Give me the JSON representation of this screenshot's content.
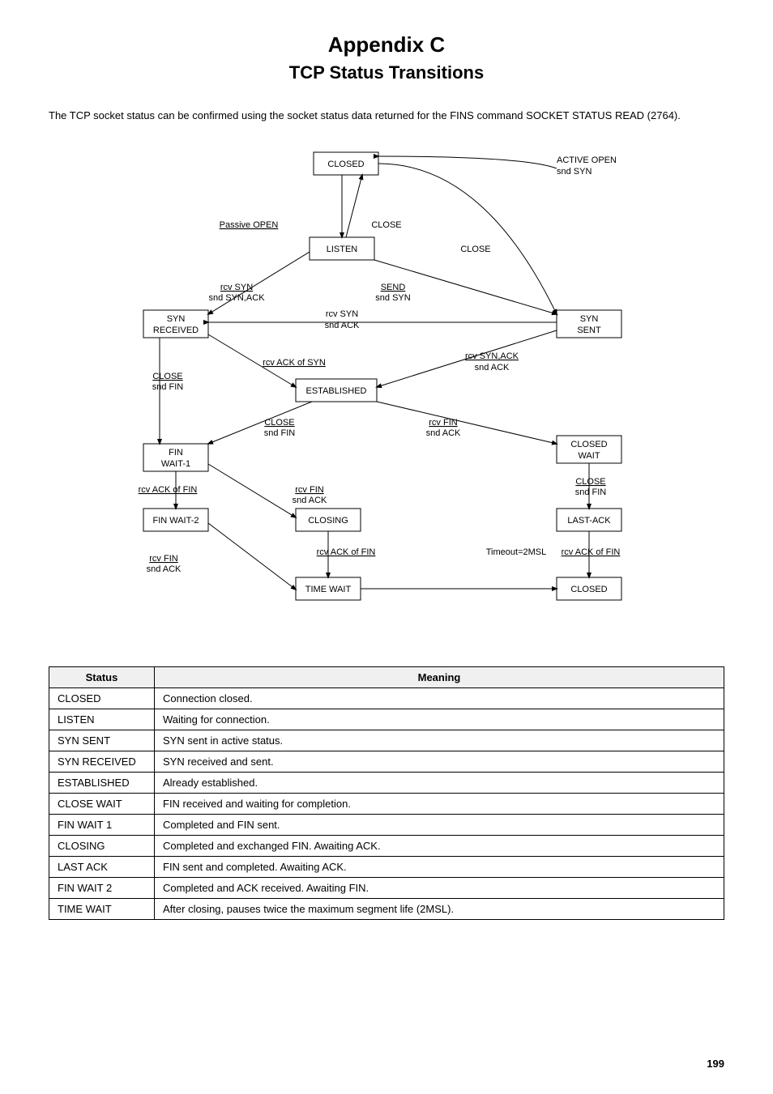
{
  "title": "Appendix C",
  "subtitle": "TCP Status Transitions",
  "intro": "The TCP socket status can be confirmed using the socket status data returned for the FINS command SOCKET STATUS READ (2764).",
  "table": {
    "headers": [
      "Status",
      "Meaning"
    ],
    "rows": [
      [
        "CLOSED",
        "Connection closed."
      ],
      [
        "LISTEN",
        "Waiting for connection."
      ],
      [
        "SYN SENT",
        "SYN sent in active status."
      ],
      [
        "SYN RECEIVED",
        "SYN received and sent."
      ],
      [
        "ESTABLISHED",
        "Already established."
      ],
      [
        "CLOSE WAIT",
        "FIN received and waiting for completion."
      ],
      [
        "FIN WAIT 1",
        "Completed and FIN sent."
      ],
      [
        "CLOSING",
        "Completed and exchanged FIN. Awaiting ACK."
      ],
      [
        "LAST ACK",
        "FIN sent and completed. Awaiting ACK."
      ],
      [
        "FIN WAIT 2",
        "Completed and ACK received. Awaiting FIN."
      ],
      [
        "TIME WAIT",
        "After closing, pauses twice the maximum segment life (2MSL)."
      ]
    ]
  },
  "page_number": "199"
}
